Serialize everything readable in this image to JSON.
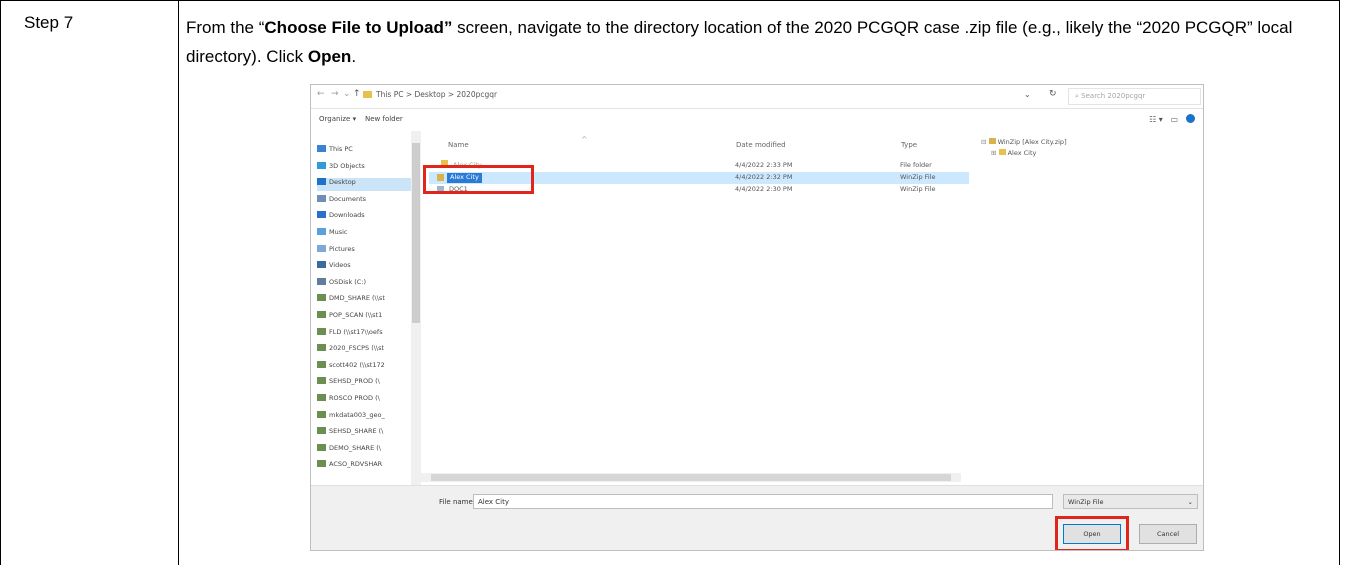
{
  "step": {
    "label": "Step 7",
    "text_1": "From the “",
    "bold_screen": "Choose File to Upload”",
    "text_2": " screen, navigate to the directory location of the 2020 PCGQR case .zip file (e.g., likely the “2020 PCGQR” local directory). Click ",
    "bold_open": "Open",
    "text_3": "."
  },
  "dialog": {
    "path": "This PC  >  Desktop  >  2020pcgqr",
    "search_placeholder": "Search 2020pcgqr",
    "toolbar": {
      "organize": "Organize ▾",
      "new_folder": "New folder"
    },
    "nav_items": [
      "This PC",
      "3D Objects",
      "Desktop",
      "Documents",
      "Downloads",
      "Music",
      "Pictures",
      "Videos",
      "OSDisk (C:)",
      "DMD_SHARE (\\\\st",
      "POP_SCAN (\\\\st1",
      "FLD (\\\\st17\\\\oefs",
      "2020_FSCPS (\\\\st",
      "scott402 (\\\\st172",
      "SEHSD_PROD (\\",
      "ROSCO PROD (\\",
      "mkdata003_geo_",
      "SEHSD_SHARE (\\",
      "DEMO_SHARE (\\",
      "ACSO_RDVSHAR"
    ],
    "selected_nav": "Desktop",
    "columns": {
      "name": "Name",
      "date": "Date modified",
      "type": "Type"
    },
    "files": [
      {
        "name": "Alex City",
        "date": "4/4/2022 2:33 PM",
        "type": "File folder"
      },
      {
        "name": "Alex City",
        "date": "4/4/2022 2:32 PM",
        "type": "WinZip File"
      },
      {
        "name": "DOC1",
        "date": "4/4/2022 2:30 PM",
        "type": "WinZip File"
      }
    ],
    "preview_tree": [
      "WinZip [Alex City.zip]",
      "Alex City"
    ],
    "file_name_label": "File name:",
    "file_name_value": "Alex City",
    "file_type": "WinZip File",
    "open_label": "Open",
    "cancel_label": "Cancel"
  },
  "colors": {
    "highlight_red": "#e0261b",
    "selection_blue": "#cce8ff",
    "folder_yellow": "#e8c04d"
  }
}
